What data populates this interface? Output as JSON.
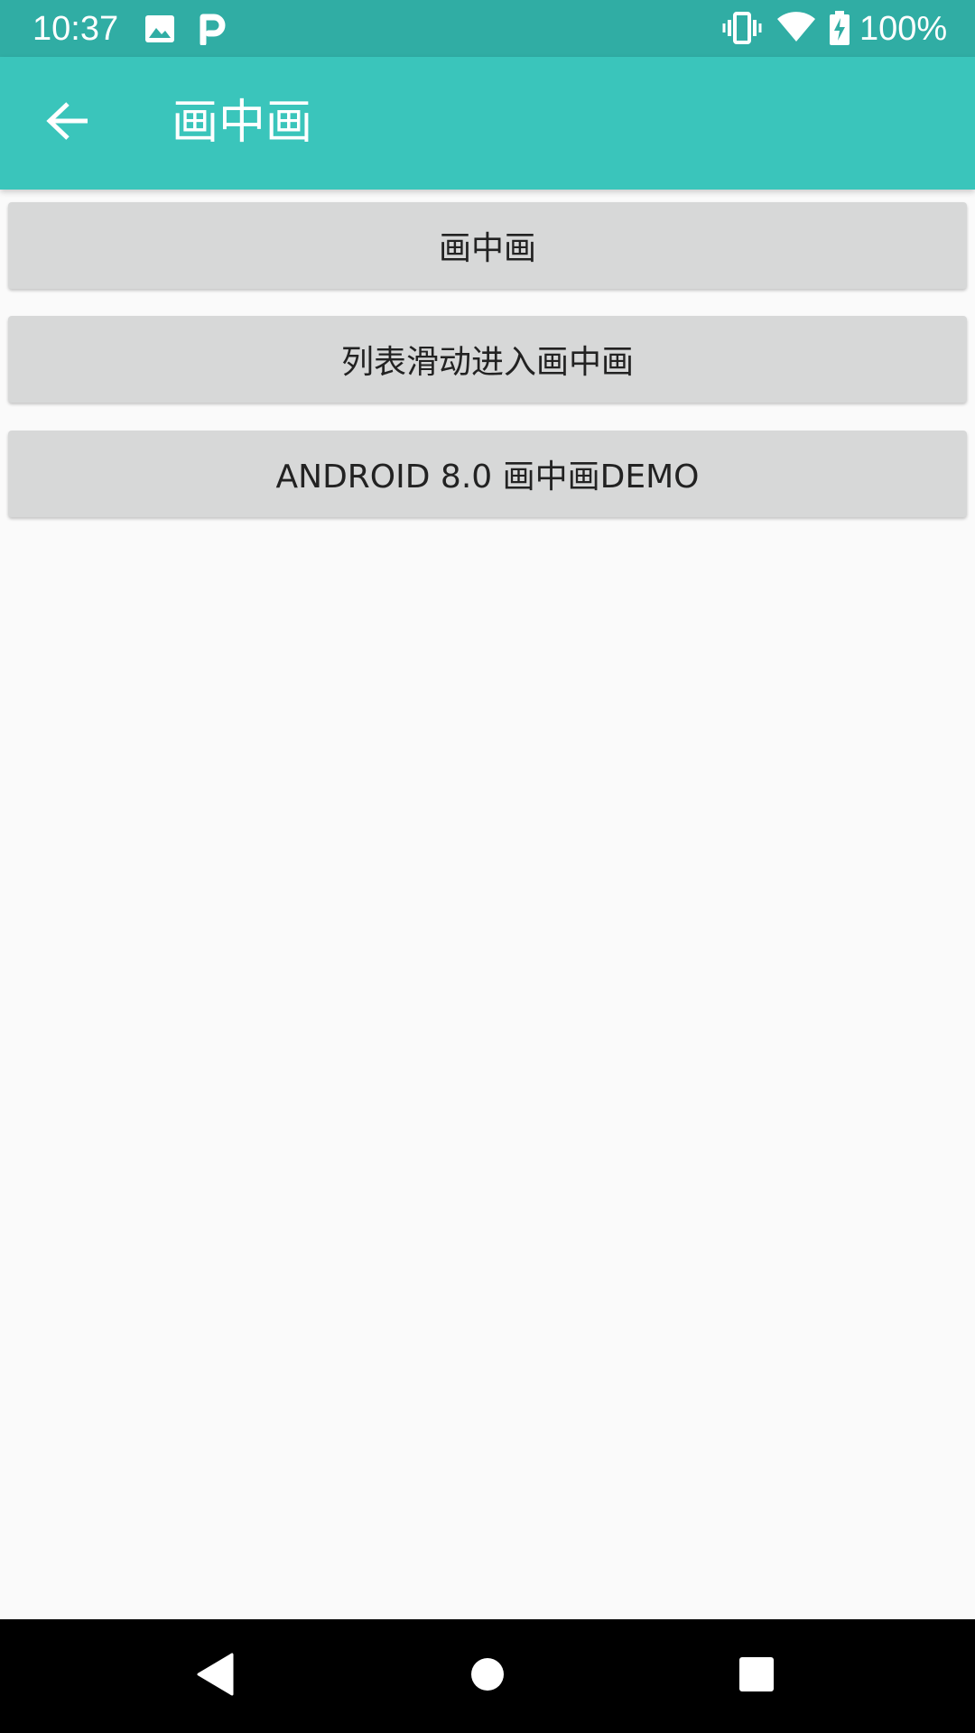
{
  "status_bar": {
    "time": "10:37",
    "left_icons": [
      "image-icon",
      "parking-icon"
    ],
    "right_icons": [
      "vibrate-icon",
      "wifi-icon",
      "battery-charging-icon"
    ],
    "battery": "100%"
  },
  "app_bar": {
    "title": "画中画",
    "background": "#3ac5bb",
    "back_icon": "arrow-back-icon"
  },
  "buttons": [
    {
      "label": "画中画"
    },
    {
      "label": "列表滑动进入画中画"
    },
    {
      "label": "ANDROID 8.0 画中画DEMO"
    }
  ],
  "nav_bar": {
    "icons": [
      "nav-back-icon",
      "nav-home-icon",
      "nav-recents-icon"
    ]
  },
  "colors": {
    "status_bar": "#30ada4",
    "app_bar": "#3ac5bb",
    "button_bg": "#d7d8d8",
    "page_bg": "#fafafa"
  }
}
